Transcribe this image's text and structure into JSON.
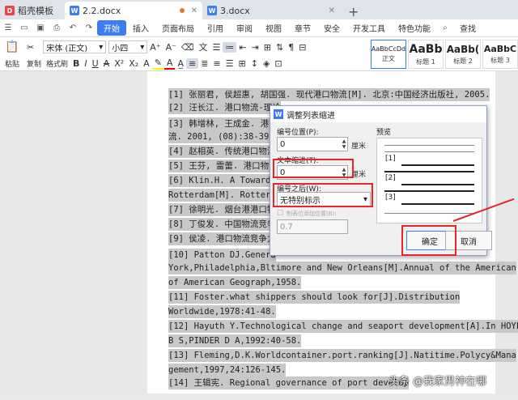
{
  "tabs": [
    {
      "label": "稻壳模板",
      "icon": "docer-icon"
    },
    {
      "label": "2.2.docx",
      "icon": "word-icon",
      "active": true
    },
    {
      "label": "3.docx",
      "icon": "word-icon"
    }
  ],
  "menu": {
    "start": "开始",
    "items": [
      "插入",
      "页面布局",
      "引用",
      "审阅",
      "视图",
      "章节",
      "安全",
      "开发工具",
      "特色功能"
    ],
    "search": "查找"
  },
  "toolbar": {
    "paste": "粘贴",
    "copy": "复制",
    "format_painter": "格式刷",
    "font": "宋体 (正文)",
    "size": "小四",
    "styles": [
      {
        "preview": "AaBbCcDd",
        "name": "正文"
      },
      {
        "preview": "AaBb",
        "name": "标题 1"
      },
      {
        "preview": "AaBb(",
        "name": "标题 2"
      },
      {
        "preview": "AaBbC",
        "name": "标题 3"
      }
    ]
  },
  "references": [
    {
      "text": "[1] 张丽君, 侯超惠, 胡国强. 现代港口物流[M]. 北京:中国经济出版社, 2005."
    },
    {
      "text": "[2] 汪长江. 港口物流-理论"
    },
    {
      "text": "[3] 韩增林, 王成金. 港口物"
    },
    {
      "text": "    流. 2001, (08):38-39."
    },
    {
      "text": "[4] 赵相英. 传统港口物流向"
    },
    {
      "text": "[5] 王芬, 雷蕾. 港口物流"
    },
    {
      "text": "[6] Klin.H. A Towards th"
    },
    {
      "text": "    Rotterdam[M]. Rotter"
    },
    {
      "text": "[7] 徐明光. 烟台港港口物"
    },
    {
      "text": "[8] 丁俊发. 中国物流竞争力"
    },
    {
      "text": "[9] 侯凌. 港口物流竞争力研"
    },
    {
      "text": "[10]     Patton DJ.Genera"
    },
    {
      "text": "    York,Philadelphia,Bltimore and New Orleans[M].Annual of the American"
    },
    {
      "text": "    of American Geograph,1958."
    },
    {
      "text": "[11]     Foster.what shippers should look for[J].Distribution"
    },
    {
      "text": "Worldwide,1978:41-48."
    },
    {
      "text": "[12]     Hayuth Y.Technological change and seaport development[A].In HOYLE"
    },
    {
      "text": "  B S,PINDER D A,1992:40-58."
    },
    {
      "text": "[13]     Fleming,D.K.Worldcontainer.port.ranking[J].Natitime.Polycy&Mana"
    },
    {
      "text": "  gement,1997,24:126-145."
    },
    {
      "text": "[14]     王辑宪. Regional governance of port develop"
    }
  ],
  "dialog": {
    "title": "调整列表缩进",
    "number_position_label": "编号位置(P):",
    "number_position_value": "0",
    "number_position_unit": "厘米",
    "text_indent_label": "文本缩进(T):",
    "text_indent_value": "0",
    "text_indent_unit": "厘米",
    "after_number_label": "编号之后(W):",
    "after_number_value": "无特别标示",
    "tab_checkbox_label": "制表位添加位置(B):",
    "tab_value": "0.7",
    "preview_label": "预览",
    "preview_items": [
      "[1]",
      "[2]",
      "[3]"
    ],
    "ok": "确定",
    "cancel": "取消"
  },
  "watermark": "头条 @我家男神在哪",
  "colors": {
    "accent": "#3c7df0",
    "highlight": "#e8262a",
    "selection": "#c8c8c8"
  }
}
